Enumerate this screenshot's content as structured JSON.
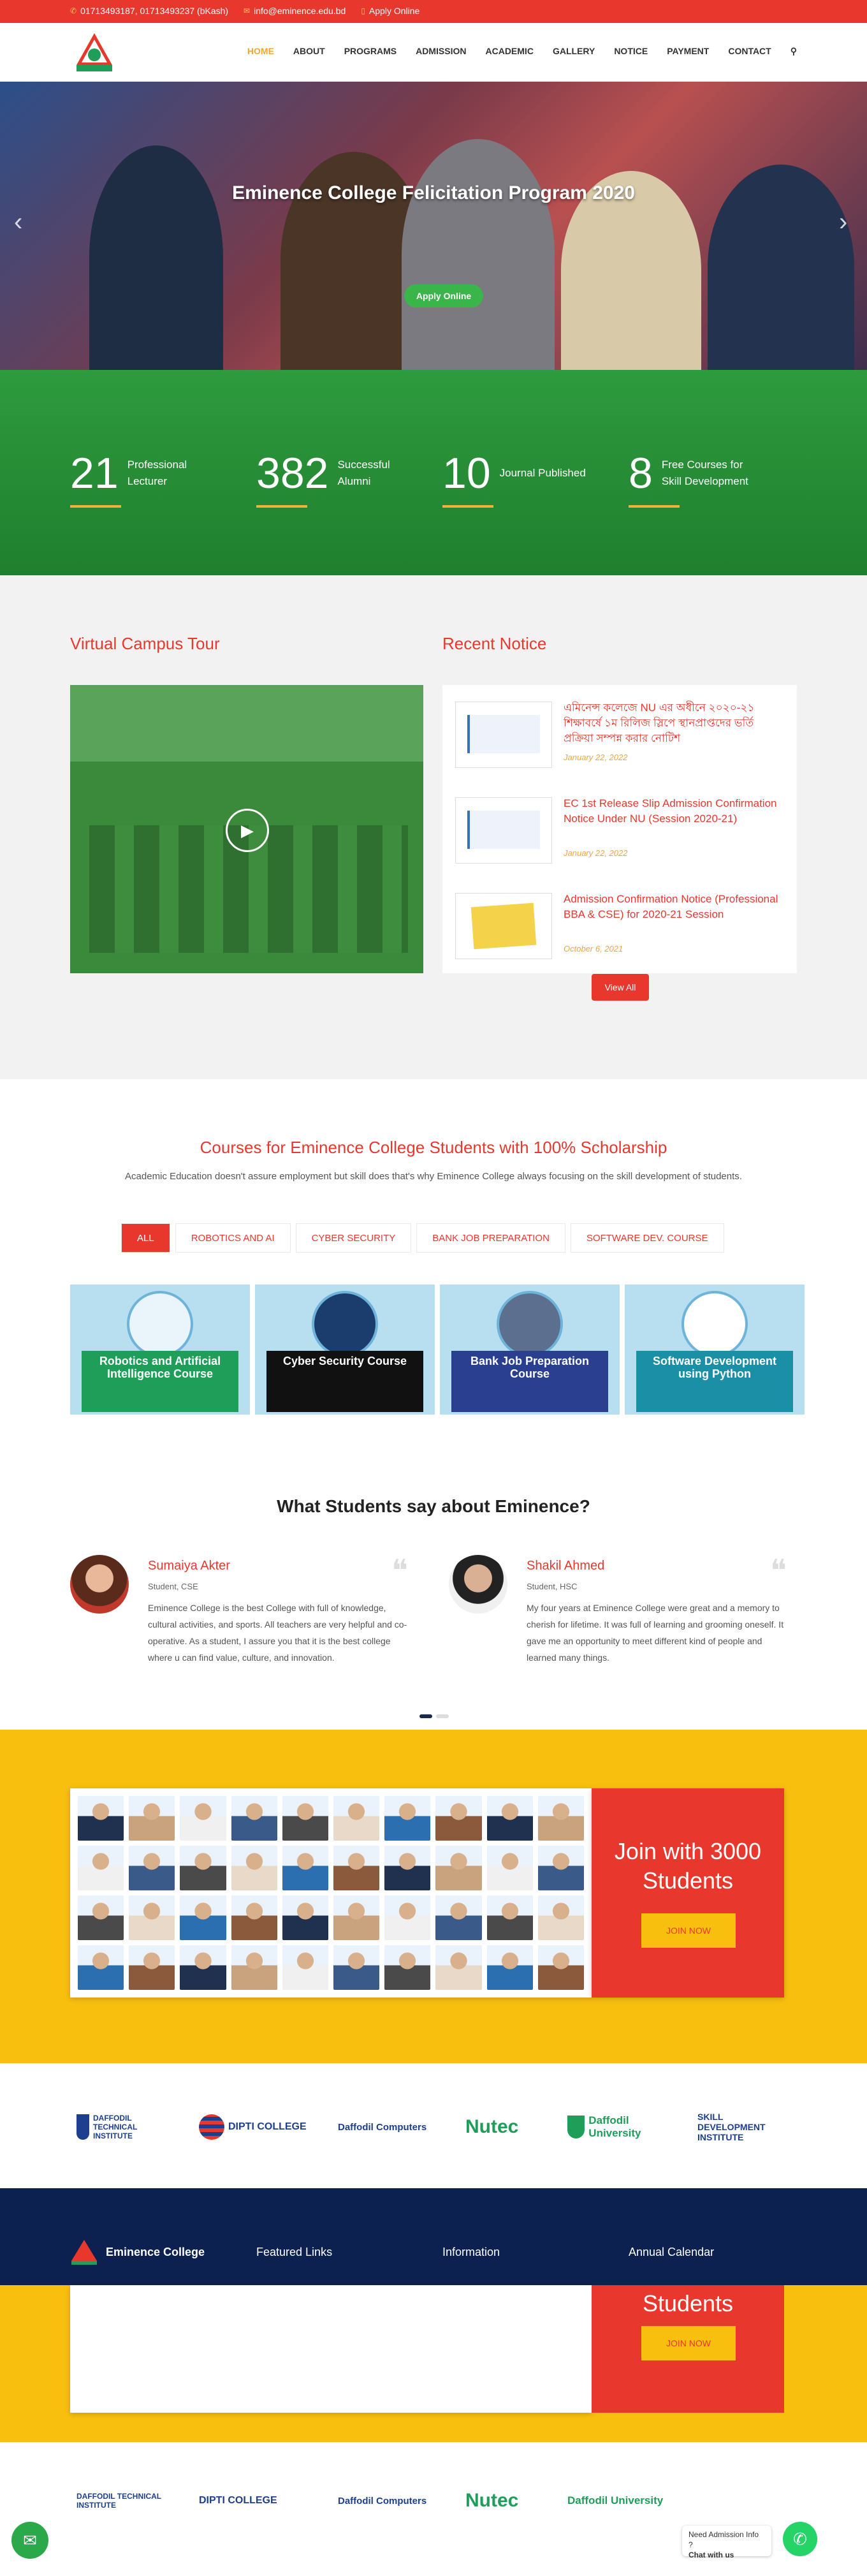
{
  "topbar": {
    "phone": "01713493187, 01713493237 (bKash)",
    "email": "info@eminence.edu.bd",
    "apply": "Apply Online"
  },
  "logo_text": "",
  "nav": [
    "HOME",
    "ABOUT",
    "PROGRAMS",
    "ADMISSION",
    "ACADEMIC",
    "GALLERY",
    "NOTICE",
    "PAYMENT",
    "CONTACT"
  ],
  "hero": {
    "title": "Eminence College Felicitation Program 2020",
    "button": "Apply Online"
  },
  "stats": [
    {
      "num": "21",
      "label": "Professional Lecturer"
    },
    {
      "num": "382",
      "label": "Successful Alumni"
    },
    {
      "num": "10",
      "label": "Journal Published"
    },
    {
      "num": "8",
      "label": "Free Courses for Skill Development"
    }
  ],
  "tour": {
    "heading": "Virtual Campus Tour"
  },
  "notices": {
    "heading": "Recent Notice",
    "items": [
      {
        "title": "এমিনেন্স কলেজে NU এর অধীনে ২০২০-২১ শিক্ষাবর্ষে ১ম রিলিজ স্লিপে স্থানপ্রাপ্তদের ভর্তি প্রক্রিয়া সম্পন্ন করার নোটিশ",
        "date": "January 22, 2022"
      },
      {
        "title": "EC 1st Release Slip Admission Confirmation Notice Under NU (Session 2020-21)",
        "date": "January 22, 2022"
      },
      {
        "title": "Admission Confirmation Notice (Professional BBA & CSE) for 2020-21 Session",
        "date": "October 6, 2021"
      }
    ],
    "view_all": "View All"
  },
  "courses": {
    "heading": "Courses for Eminence College Students with 100% Scholarship",
    "subtitle": "Academic Education doesn't assure employment but skill does that's why Eminence College always focusing on the skill development of students.",
    "filters": [
      "ALL",
      "ROBOTICS AND AI",
      "CYBER SECURITY",
      "BANK JOB PREPARATION",
      "SOFTWARE DEV. COURSE"
    ],
    "cards": [
      {
        "title": "Robotics and Artificial Intelligence Course",
        "color": "#1f9e5a"
      },
      {
        "title": "Cyber Security Course",
        "color": "#111111"
      },
      {
        "title": "Bank Job Preparation Course",
        "color": "#2a3f8f"
      },
      {
        "title": "Software Development using Python",
        "color": "#1a8fa6"
      }
    ]
  },
  "testimonials": {
    "heading": "What  Students say about Eminence?",
    "items": [
      {
        "name": "Sumaiya Akter",
        "role": "Student, CSE",
        "text": "Eminence College is the best College with full of knowledge, cultural activities, and sports. All teachers are very helpful and co-operative. As a student, I assure you that it is the best college where u can find value, culture, and innovation."
      },
      {
        "name": "Shakil Ahmed",
        "role": "Student, HSC",
        "text": "My four years at Eminence College were great and a memory to cherish for lifetime. It was full of learning and grooming oneself. It gave me an opportunity to meet different kind of people and learned many things."
      }
    ]
  },
  "join": {
    "title": "Join with 3000 Students",
    "button": "JOIN NOW"
  },
  "partners": [
    "DAFFODIL TECHNICAL INSTITUTE",
    "DIPTI COLLEGE",
    "Daffodil Computers",
    "Nutec",
    "Daffodil University",
    "SKILL DEVELOPMENT INSTITUTE"
  ],
  "footer": {
    "brand": "Eminence College",
    "featured": "Featured Links",
    "information": "Information",
    "calendar": "Annual Calendar"
  },
  "whatsapp": {
    "line1": "Need Admission Info ?",
    "line2": "Chat with us"
  }
}
